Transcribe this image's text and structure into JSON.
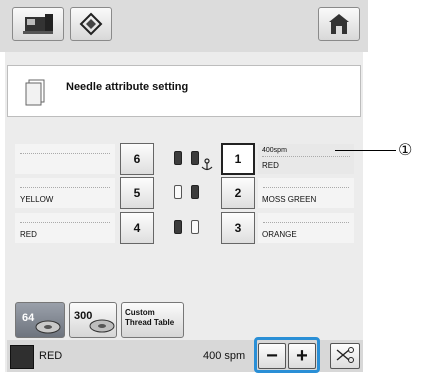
{
  "header": {
    "title": "Needle attribute setting"
  },
  "rows": [
    {
      "left_color": "",
      "left_needle": "6",
      "right_needle": "1",
      "right_speed": "400spm",
      "right_color": "RED"
    },
    {
      "left_color": "YELLOW",
      "left_needle": "5",
      "right_needle": "2",
      "right_speed": "",
      "right_color": "MOSS GREEN"
    },
    {
      "left_color": "RED",
      "left_needle": "4",
      "right_needle": "3",
      "right_speed": "",
      "right_color": "ORANGE"
    }
  ],
  "thread_buttons": {
    "btn_64": "64",
    "btn_300": "300",
    "custom": "Custom Thread Table"
  },
  "footer": {
    "color_name": "RED",
    "speed": "400 spm",
    "minus": "−",
    "plus": "+"
  },
  "callout": "①",
  "colors": {
    "highlight": "#2a8fd6",
    "dark_swatch": "#2f2f2f"
  }
}
